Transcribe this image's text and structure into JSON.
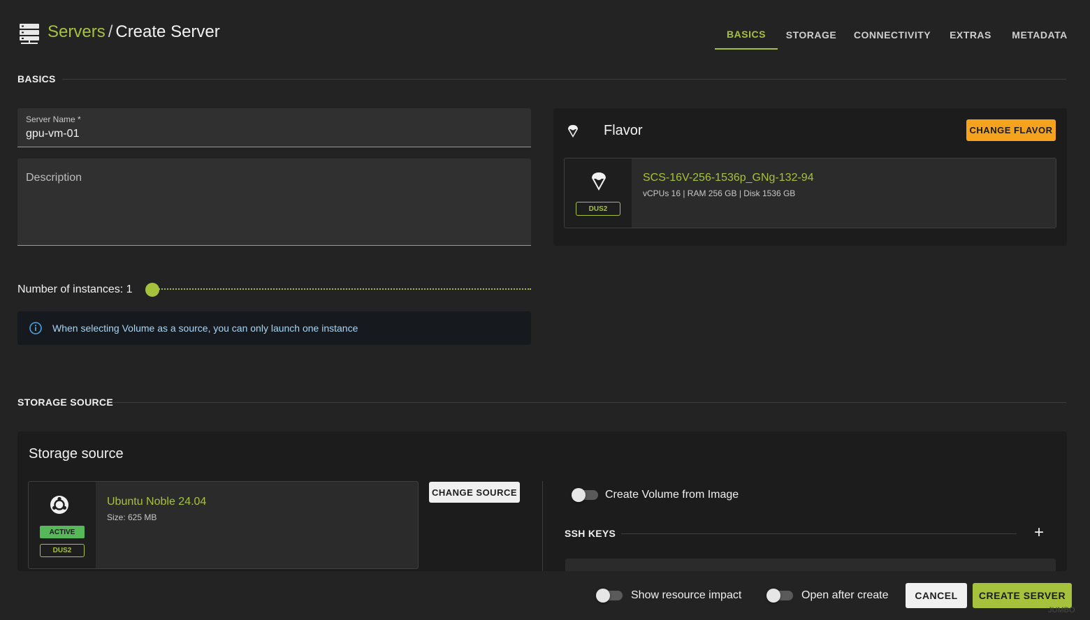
{
  "header": {
    "breadcrumb_parent": "Servers",
    "breadcrumb_separator": "/",
    "breadcrumb_current": "Create Server",
    "tabs": [
      {
        "label": "BASICS",
        "active": true
      },
      {
        "label": "STORAGE",
        "active": false
      },
      {
        "label": "CONNECTIVITY",
        "active": false
      },
      {
        "label": "EXTRAS",
        "active": false
      },
      {
        "label": "METADATA",
        "active": false
      }
    ]
  },
  "basics": {
    "section_title": "BASICS",
    "server_name_label": "Server Name *",
    "server_name_value": "gpu-vm-01",
    "description_placeholder": "Description",
    "instances_label": "Number of instances: 1",
    "instances_value": 1,
    "info_message": "When selecting Volume as a source, you can only launch one instance"
  },
  "flavor": {
    "title": "Flavor",
    "change_button": "CHANGE FLAVOR",
    "name": "SCS-16V-256-1536p_GNg-132-94",
    "specs": "vCPUs 16 | RAM 256 GB | Disk 1536 GB",
    "region_badge": "DUS2"
  },
  "storage": {
    "section_title": "STORAGE SOURCE",
    "panel_title": "Storage source",
    "source_name": "Ubuntu Noble 24.04",
    "source_size": "Size: 625 MB",
    "status_badge": "ACTIVE",
    "region_badge": "DUS2",
    "change_button": "CHANGE SOURCE",
    "create_volume_label": "Create Volume from Image",
    "create_volume_enabled": false,
    "ssh_keys_title": "SSH KEYS",
    "add_icon_glyph": "+"
  },
  "footer": {
    "show_impact_label": "Show resource impact",
    "open_after_label": "Open after create",
    "cancel_button": "CANCEL",
    "create_button": "CREATE SERVER",
    "watermark": "JUMBO"
  },
  "colors": {
    "accent": "#a6c13c",
    "orange": "#f5a31d",
    "background": "#232323",
    "info_text": "#a9d6f5"
  }
}
